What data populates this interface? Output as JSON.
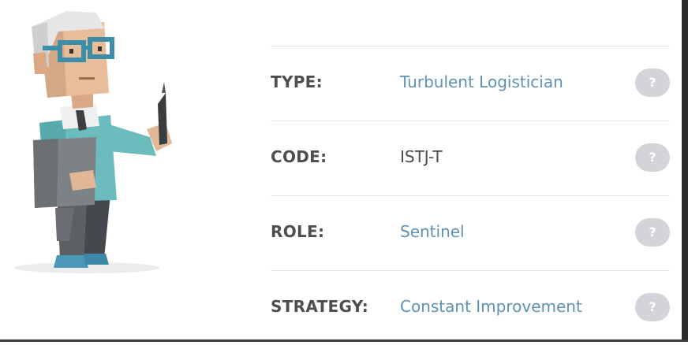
{
  "rows": [
    {
      "label": "TYPE:",
      "value": "Turbulent Logistician",
      "help": "?"
    },
    {
      "label": "CODE:",
      "value": "ISTJ-T",
      "help": "?"
    },
    {
      "label": "ROLE:",
      "value": "Sentinel",
      "help": "?"
    },
    {
      "label": "STRATEGY:",
      "value": "Constant Improvement",
      "help": "?"
    }
  ],
  "colors": {
    "value_link": "#5d92b4",
    "label_text": "#4e4e4e",
    "help_button": "#d3d4d9",
    "divider": "#e4e4e4",
    "character_shirt": "#6fbfbf",
    "character_glasses": "#3c8ea8"
  },
  "icons": {
    "help": "question-mark-icon",
    "illustration": "logistician-character-illustration"
  }
}
